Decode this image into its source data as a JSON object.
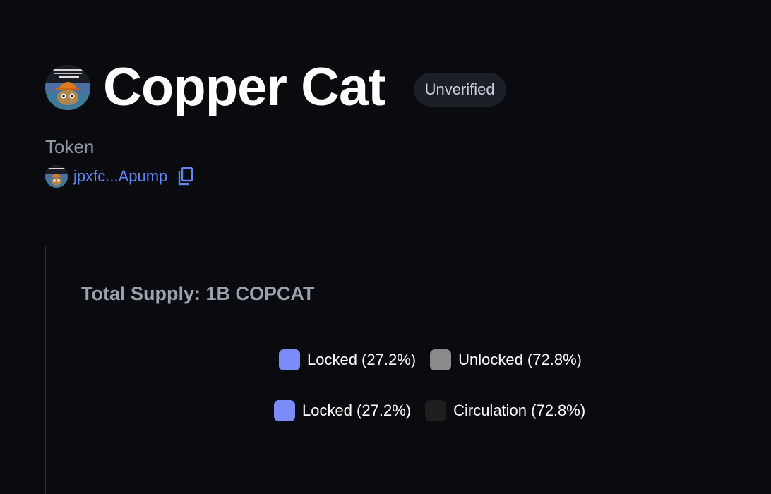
{
  "token": {
    "name": "Copper Cat",
    "badge": "Unverified",
    "type_label": "Token",
    "address_short": "jpxfc...Apump"
  },
  "supply": {
    "label": "Total Supply: 1B COPCAT"
  },
  "legend_primary": [
    {
      "label": "Locked (27.2%)",
      "color": "#7b8cf8"
    },
    {
      "label": "Unlocked (72.8%)",
      "color": "#8a8a8a"
    }
  ],
  "legend_secondary": [
    {
      "label": "Locked (27.2%)",
      "color": "#7b8cf8"
    },
    {
      "label": "Circulation (72.8%)",
      "color": "#1e1e1e"
    }
  ],
  "icons": {
    "avatar": "copper-cat-avatar-icon",
    "copy": "copy-icon"
  },
  "colors": {
    "link": "#5f86f4",
    "background": "#0a0b0f"
  }
}
